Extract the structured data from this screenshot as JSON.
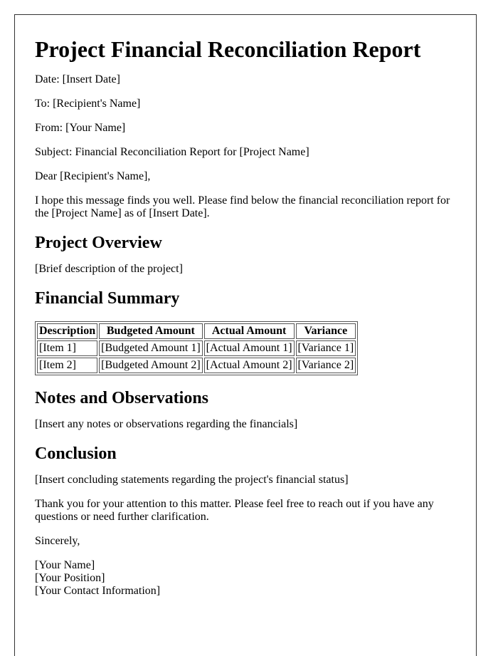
{
  "title": "Project Financial Reconciliation Report",
  "header_fields": {
    "date": "Date: [Insert Date]",
    "to": "To: [Recipient's Name]",
    "from": "From: [Your Name]",
    "subject": "Subject: Financial Reconciliation Report for [Project Name]"
  },
  "salutation": "Dear [Recipient's Name],",
  "intro": "I hope this message finds you well. Please find below the financial reconciliation report for the [Project Name] as of [Insert Date].",
  "sections": {
    "overview": {
      "heading": "Project Overview",
      "body": "[Brief description of the project]"
    },
    "summary": {
      "heading": "Financial Summary",
      "table": {
        "headers": [
          "Description",
          "Budgeted Amount",
          "Actual Amount",
          "Variance"
        ],
        "rows": [
          [
            "[Item 1]",
            "[Budgeted Amount 1]",
            "[Actual Amount 1]",
            "[Variance 1]"
          ],
          [
            "[Item 2]",
            "[Budgeted Amount 2]",
            "[Actual Amount 2]",
            "[Variance 2]"
          ]
        ]
      }
    },
    "notes": {
      "heading": "Notes and Observations",
      "body": "[Insert any notes or observations regarding the financials]"
    },
    "conclusion": {
      "heading": "Conclusion",
      "body": "[Insert concluding statements regarding the project's financial status]"
    }
  },
  "closing_text": "Thank you for your attention to this matter. Please feel free to reach out if you have any questions or need further clarification.",
  "signoff": "Sincerely,",
  "signature": {
    "name": "[Your Name]",
    "position": "[Your Position]",
    "contact": "[Your Contact Information]"
  }
}
